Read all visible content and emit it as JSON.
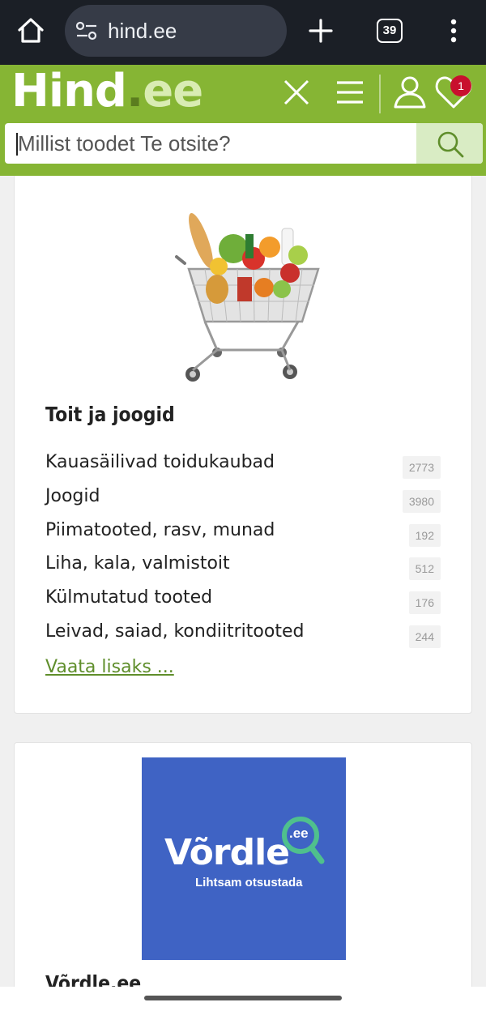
{
  "browser": {
    "url": "hind.ee",
    "tab_count": "39",
    "icons": [
      "home-icon",
      "site-settings-icon",
      "plus-icon",
      "tab-switcher-icon",
      "more-icon"
    ]
  },
  "header": {
    "logo_main": "Hind",
    "logo_dot": ".",
    "logo_ee": "ee",
    "notification_count": "1",
    "icons": [
      "close-icon",
      "menu-icon",
      "user-icon",
      "heart-icon"
    ],
    "colors": {
      "brand_green": "#86b534",
      "badge_red": "#c8102e"
    }
  },
  "search": {
    "placeholder": "Millist toodet Te otsite?",
    "icon": "search-icon"
  },
  "category_card": {
    "image": "shopping-cart-groceries",
    "title": "Toit ja joogid",
    "subcategories": [
      {
        "label": "Kauasäilivad toidukaubad",
        "count": "2773"
      },
      {
        "label": "Joogid",
        "count": "3980"
      },
      {
        "label": "Piimatooted, rasv, munad",
        "count": "192"
      },
      {
        "label": "Liha, kala, valmistoit",
        "count": "512"
      },
      {
        "label": "Külmutatud tooted",
        "count": "176"
      },
      {
        "label": "Leivad, saiad, kondiitritooted",
        "count": "244"
      }
    ],
    "more_link": "Vaata lisaks ..."
  },
  "vordle_card": {
    "banner_word": "Võrdle",
    "banner_ee": ".ee",
    "banner_tagline": "Lihtsam otsustada",
    "title": "Võrdle.ee",
    "colors": {
      "banner_bg": "#3f63c4",
      "lens": "#4fc08d"
    }
  }
}
